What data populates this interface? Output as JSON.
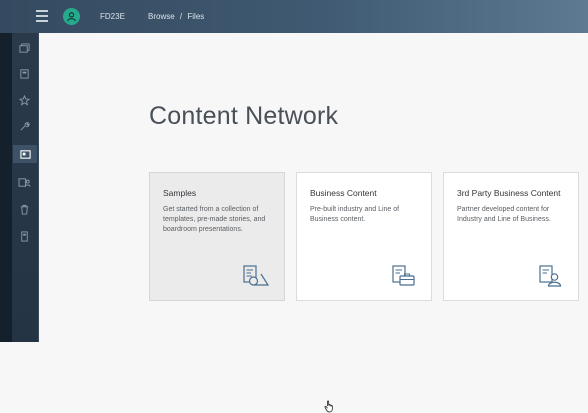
{
  "topbar": {
    "system_id": "FD23E",
    "breadcrumb": [
      "Browse",
      "/",
      "Files"
    ]
  },
  "sidebar": {
    "items": [
      {
        "icon": "files-icon",
        "active": false
      },
      {
        "icon": "copy-icon",
        "active": false
      },
      {
        "icon": "star-icon",
        "active": false
      },
      {
        "icon": "wrench-icon",
        "active": false
      },
      {
        "icon": "content-network-icon",
        "active": true
      },
      {
        "icon": "users-icon",
        "active": false
      },
      {
        "icon": "trash-icon",
        "active": false
      },
      {
        "icon": "bookmark-icon",
        "active": false
      }
    ]
  },
  "main": {
    "title": "Content Network",
    "cards": [
      {
        "title": "Samples",
        "description": "Get started from a collection of templates, pre-made stories, and boardroom presentations.",
        "icon": "samples-icon"
      },
      {
        "title": "Business Content",
        "description": "Pre-built industry and Line of Business content.",
        "icon": "business-content-icon"
      },
      {
        "title": "3rd Party Business Content",
        "description": "Partner developed content for Industry and Line of Business.",
        "icon": "partner-content-icon"
      }
    ]
  },
  "colors": {
    "topbar": "#354a5f",
    "sidebar": "#2a3a4a",
    "avatar": "#27a98e",
    "icon_accent": "#4a6f8f",
    "card_hover": "#ebebeb"
  }
}
